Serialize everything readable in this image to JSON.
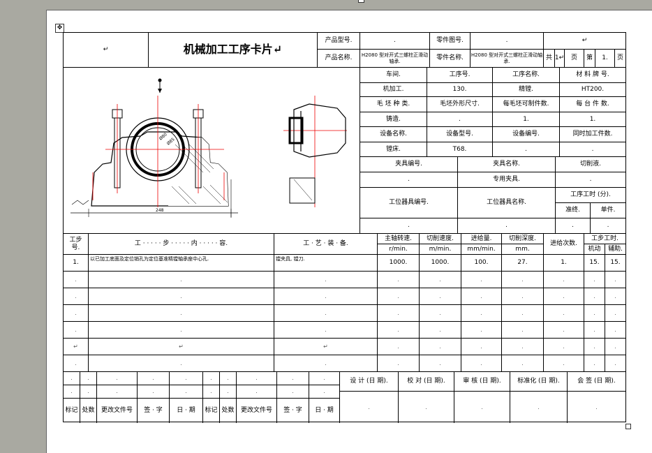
{
  "doc": {
    "move_glyph": "✥"
  },
  "header": {
    "blank_mark": "↵",
    "title": "机械加工工序卡片↵",
    "product_model_label": "产品型号.",
    "product_model_value": ".",
    "part_drawing_label": "零件图号.",
    "part_drawing_value": ".",
    "top_right": "↵",
    "product_name_label": "产品名称.",
    "product_name_value": "H2080 型对开式三螺柱正滑动轴承.",
    "part_name_label": "零件名称.",
    "part_name_value": "H2080 型对开式三螺柱正滑动轴承.",
    "total_label": "共",
    "total_value": "1↵",
    "page_unit": "页",
    "page_label": "第",
    "page_value": "1.",
    "page_unit2": "页"
  },
  "info": {
    "r1": [
      "车间.",
      "工序号.",
      "工序名称.",
      "材 料 牌 号."
    ],
    "r2": [
      "机加工.",
      "130.",
      "精镗.",
      "HT200."
    ],
    "r3": [
      "毛 坯 种 类.",
      "毛坯外形尺寸.",
      "每毛坯可制件数.",
      "每 台 件 数."
    ],
    "r4": [
      "铸造.",
      ".",
      "1.",
      "1."
    ],
    "r5": [
      "设备名称.",
      "设备型号.",
      "设备编号.",
      "同时加工件数."
    ],
    "r6": [
      "镗床.",
      "T68.",
      ".",
      "."
    ],
    "fixture": [
      "夹具编号.",
      "夹具名称.",
      "切削液."
    ],
    "fixture_val": [
      ".",
      "专用夹具.",
      "."
    ],
    "station_tool_no": "工位器具编号.",
    "station_tool_name": "工位器具名称.",
    "time_label": "工序工时 (分).",
    "time_prep": "准终.",
    "time_unit": "单件.",
    "time_vals": [
      ".",
      ".",
      ".",
      "."
    ]
  },
  "drawing": {
    "dim1": "Ø80",
    "dim2": "Ø85",
    "dim3": "248"
  },
  "steps": {
    "h_no": "工步\n号.",
    "h_content": "工 · · · · · 步 · · · · · 内 · · · · · 容.",
    "h_equip": "工 · 艺 · 装 · 备.",
    "h_speed": "主轴转速.",
    "h_speed_u": "r/min.",
    "h_vel": "切削速度.",
    "h_vel_u": "m/min.",
    "h_feed": "进给量.",
    "h_feed_u": "mm/min.",
    "h_depth": "切削深度.",
    "h_depth_u": "mm.",
    "h_passes": "进给次数.",
    "h_time": "工步工时.",
    "h_time_m": "机动",
    "h_time_a": "辅助.",
    "rows": [
      [
        "1.",
        "以已加工底面及定位销孔为定位基准精镗轴承座中心孔.",
        "镗夹具, 镗刀.",
        "1000.",
        "1000.",
        "100.",
        "27.",
        "1.",
        "15.",
        "15."
      ],
      [
        ".",
        ".",
        ".",
        ".",
        ".",
        ".",
        ".",
        ".",
        ".",
        "."
      ],
      [
        ".",
        ".",
        ".",
        ".",
        ".",
        ".",
        ".",
        ".",
        ".",
        "."
      ],
      [
        ".",
        ".",
        ".",
        ".",
        ".",
        ".",
        ".",
        ".",
        ".",
        "."
      ],
      [
        ".",
        ".",
        ".",
        ".",
        ".",
        ".",
        ".",
        ".",
        ".",
        "."
      ],
      [
        "↵",
        "↵",
        "↵",
        ".",
        ".",
        ".",
        ".",
        ".",
        ".",
        "."
      ],
      [
        ".",
        ".",
        ".",
        ".",
        ".",
        ".",
        ".",
        ".",
        ".",
        "."
      ]
    ]
  },
  "footer": {
    "marks": [
      ".",
      ".",
      ".",
      ".",
      ".",
      ".",
      ".",
      ".",
      ".",
      "."
    ],
    "labels": [
      "标记",
      "处数",
      "更改文件号",
      "签 · 字",
      "日 · 期",
      "标记",
      "处数",
      "更改文件号",
      "签 · 字",
      "日 · 期"
    ],
    "sign_labels": [
      "设 计 (日 期).",
      "校 对 (日 期).",
      "审 核 (日 期).",
      "标准化 (日 期).",
      "会 签 (日 期)."
    ],
    "sign_vals": [
      ".",
      ".",
      ".",
      ".",
      "."
    ]
  }
}
